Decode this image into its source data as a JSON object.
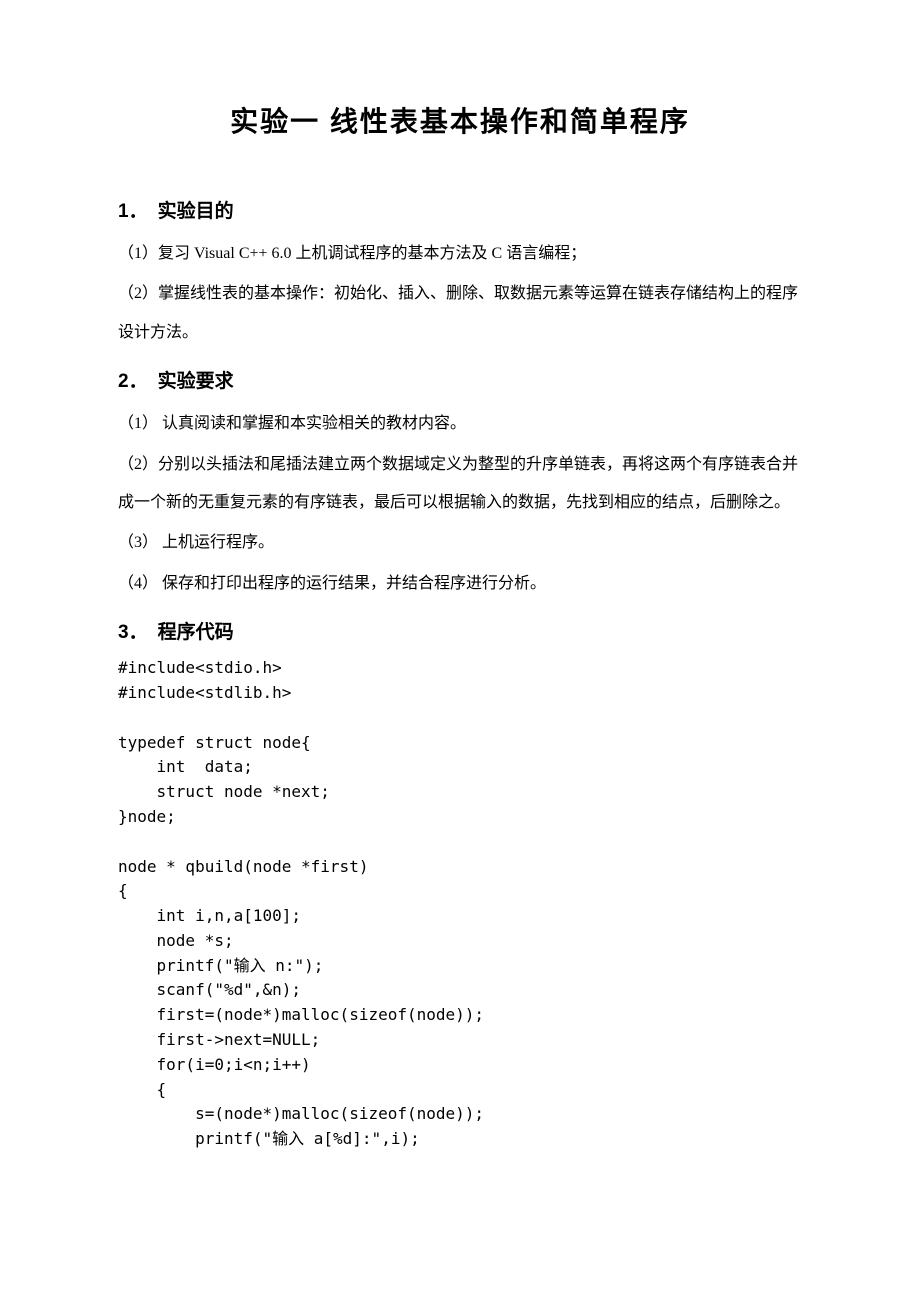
{
  "title": "实验一   线性表基本操作和简单程序",
  "sections": {
    "s1": {
      "num": "1．",
      "label": "实验目的",
      "p1": "（1）复习 Visual C++ 6.0 上机调试程序的基本方法及 C 语言编程；",
      "p2": "（2）掌握线性表的基本操作：初始化、插入、删除、取数据元素等运算在链表存储结构上的程序设计方法。"
    },
    "s2": {
      "num": "2．",
      "label": "实验要求",
      "p1": "（1） 认真阅读和掌握和本实验相关的教材内容。",
      "p2": "（2）分别以头插法和尾插法建立两个数据域定义为整型的升序单链表，再将这两个有序链表合并成一个新的无重复元素的有序链表，最后可以根据输入的数据，先找到相应的结点，后删除之。",
      "p3": "（3） 上机运行程序。",
      "p4": "（4） 保存和打印出程序的运行结果，并结合程序进行分析。"
    },
    "s3": {
      "num": "3．",
      "label": "程序代码",
      "code": "#include<stdio.h>\n#include<stdlib.h>\n\ntypedef struct node{\n    int  data;\n    struct node *next;\n}node;\n\nnode * qbuild(node *first)\n{\n    int i,n,a[100];\n    node *s;\n    printf(\"输入 n:\");\n    scanf(\"%d\",&n);\n    first=(node*)malloc(sizeof(node));\n    first->next=NULL;\n    for(i=0;i<n;i++)\n    {\n        s=(node*)malloc(sizeof(node));\n        printf(\"输入 a[%d]:\",i);"
    }
  }
}
